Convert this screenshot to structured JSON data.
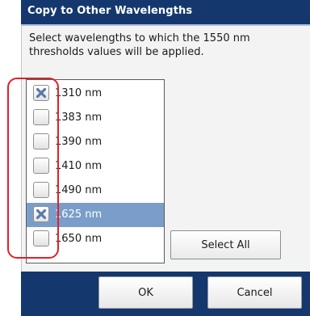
{
  "dialog": {
    "title": "Copy to Other Wavelengths",
    "description": "Select wavelengths to which the 1550 nm thresholds values will be applied.",
    "wavelengths": [
      {
        "label": "1310 nm",
        "checked": true,
        "selected": false
      },
      {
        "label": "1383 nm",
        "checked": false,
        "selected": false
      },
      {
        "label": "1390 nm",
        "checked": false,
        "selected": false
      },
      {
        "label": "1410 nm",
        "checked": false,
        "selected": false
      },
      {
        "label": "1490 nm",
        "checked": false,
        "selected": false
      },
      {
        "label": "1625 nm",
        "checked": true,
        "selected": true
      },
      {
        "label": "1650 nm",
        "checked": false,
        "selected": false
      }
    ],
    "select_all_label": "Select All",
    "ok_label": "OK",
    "cancel_label": "Cancel"
  },
  "colors": {
    "titlebar": "#14386e",
    "selection": "#7a9ec9",
    "check_mark": "#5a7aa8",
    "annotation": "#e0202a"
  }
}
